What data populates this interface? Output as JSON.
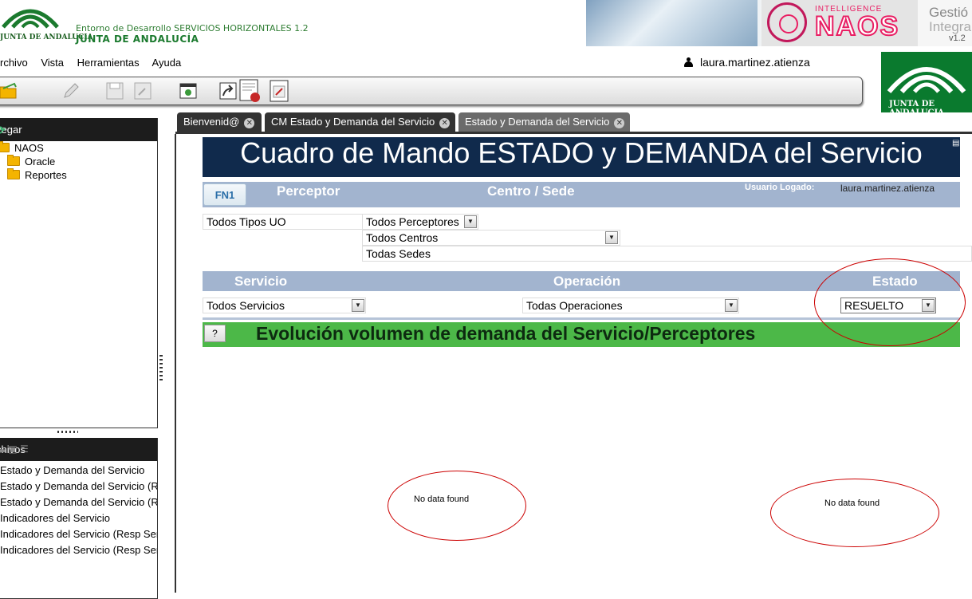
{
  "header": {
    "env_title": "Entorno de Desarrollo SERVICIOS HORIZONTALES 1.2",
    "org": "JUNTA DE ANDALUCÍA",
    "logo_text": "JUNTA DE ANDALUCIA",
    "brand_intel": "INTELLIGENCE",
    "brand_naos": "NAOS",
    "brand_gestion": "Gestió",
    "brand_integra": "Integra",
    "brand_version": "v1.2"
  },
  "menu": [
    "rchivo",
    "Vista",
    "Herramientas",
    "Ayuda"
  ],
  "user": {
    "name": "laura.martinez.atienza"
  },
  "navigator": {
    "title": "vegar",
    "items": [
      {
        "label": "NAOS",
        "level": 0
      },
      {
        "label": "Oracle",
        "level": 1
      },
      {
        "label": "Reportes",
        "level": 1
      }
    ]
  },
  "files_panel": {
    "title": "chivos",
    "items": [
      "Estado y Demanda del Servicio",
      "Estado y Demanda del Servicio (R",
      "Estado y Demanda del Servicio (R",
      "Indicadores del Servicio",
      "Indicadores del Servicio (Resp Ser",
      "Indicadores del Servicio (Resp Ser"
    ]
  },
  "tabs": [
    {
      "label": "Bienvenid@",
      "active": false
    },
    {
      "label": "CM Estado y Demanda del Servicio",
      "active": false
    },
    {
      "label": "Estado y Demanda del Servicio",
      "active": true
    }
  ],
  "dashboard": {
    "title": "Cuadro de Mando ESTADO y DEMANDA del Servicio",
    "fn_button": "FN1",
    "col_perceptor": "Perceptor",
    "col_centro": "Centro / Sede",
    "user_label": "Usuario Logado:",
    "user_value": "laura.martinez.atienza",
    "filters": {
      "tipos_uo": "Todos Tipos UO",
      "perceptores": "Todos Perceptores",
      "centros": "Todos Centros",
      "sedes": "Todas Sedes"
    },
    "col_servicio": "Servicio",
    "col_operacion": "Operación",
    "col_estado": "Estado",
    "servicio_value": "Todos Servicios",
    "operacion_value": "Todas Operaciones",
    "estado_value": "RESUELTO",
    "help_button": "?",
    "section_title": "Evolución volumen de demanda del Servicio/Perceptores",
    "chart_left_message": "No data found",
    "chart_right_message": "No data found"
  },
  "colors": {
    "title_bg": "#102a4c",
    "header_bg": "#a2b4cf",
    "section_bg": "#4cb848",
    "annotation": "#cc0000"
  }
}
